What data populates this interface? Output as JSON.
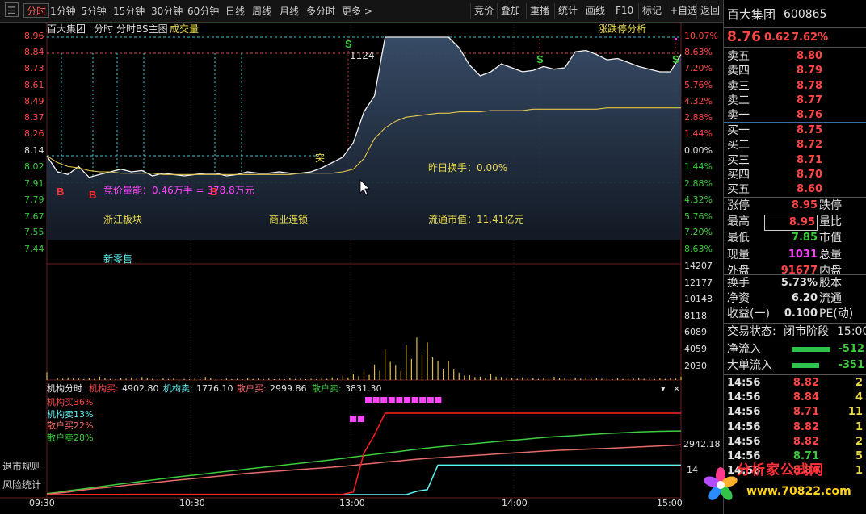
{
  "toolbar": {
    "tabs": [
      "分时",
      "1分钟",
      "5分钟",
      "15分钟",
      "30分钟",
      "60分钟",
      "日线",
      "周线",
      "月线",
      "多分时",
      "更多 >"
    ],
    "right": [
      "竞价",
      "叠加",
      "重播",
      "统计",
      "画线",
      "F10",
      "标记",
      "+自选",
      "返回"
    ]
  },
  "chart": {
    "header": {
      "name": "百大集团",
      "mode": "分时",
      "indicator": "分时BS主图",
      "volume_label": "成交量",
      "limit_analysis": "涨跌停分析"
    },
    "y_prices": [
      "8.96",
      "8.84",
      "8.73",
      "8.61",
      "8.49",
      "8.37",
      "8.26",
      "8.14",
      "8.02",
      "7.91",
      "7.79",
      "7.67",
      "7.55",
      "7.44"
    ],
    "y_pcts": [
      "10.07%",
      "8.63%",
      "7.20%",
      "5.76%",
      "4.32%",
      "2.88%",
      "1.44%",
      "0.00%",
      "1.44%",
      "2.88%",
      "4.32%",
      "5.76%",
      "7.20%",
      "8.63%"
    ],
    "vol_ticks": [
      "14207",
      "12177",
      "10148",
      "8118",
      "6089",
      "4059",
      "2030"
    ],
    "annotations": {
      "peak_volume": "1124",
      "tu": "突",
      "call_auction": "竞价量能：0.46万手 = 378.8万元",
      "yesterday_turnover": "昨日换手：0.00%",
      "sector": "浙江板块",
      "industry": "商业连锁",
      "float_value": "流通市值：11.41亿元",
      "concept": "新零售"
    },
    "bs_labels": {
      "b": "B",
      "s": "S"
    },
    "time_axis": [
      "09:30",
      "10:30",
      "13:00",
      "14:00",
      "15:00"
    ],
    "price_series": [
      8.07,
      7.95,
      7.93,
      7.99,
      7.91,
      7.93,
      7.95,
      7.97,
      7.95,
      7.96,
      7.92,
      7.94,
      7.93,
      7.92,
      7.93,
      7.94,
      7.94,
      7.92,
      7.93,
      7.95,
      7.94,
      7.94,
      7.95,
      7.94,
      7.94,
      7.95,
      7.98,
      8.02,
      8.06,
      8.17,
      8.4,
      8.52,
      8.96,
      8.96,
      8.96,
      8.96,
      8.96,
      8.96,
      8.96,
      8.88,
      8.75,
      8.67,
      8.7,
      8.76,
      8.73,
      8.7,
      8.71,
      8.74,
      8.72,
      8.73,
      8.85,
      8.86,
      8.83,
      8.79,
      8.8,
      8.77,
      8.74,
      8.72,
      8.7,
      8.7,
      8.83
    ],
    "avg_series": [
      8.07,
      8.02,
      7.99,
      7.98,
      7.96,
      7.95,
      7.95,
      7.94,
      7.94,
      7.94,
      7.94,
      7.93,
      7.93,
      7.93,
      7.93,
      7.93,
      7.93,
      7.93,
      7.93,
      7.93,
      7.93,
      7.93,
      7.93,
      7.93,
      7.94,
      7.94,
      7.94,
      7.94,
      7.95,
      7.97,
      8.05,
      8.2,
      8.28,
      8.33,
      8.36,
      8.37,
      8.38,
      8.39,
      8.39,
      8.4,
      8.4,
      8.4,
      8.41,
      8.41,
      8.41,
      8.41,
      8.42,
      8.42,
      8.42,
      8.42,
      8.42,
      8.42,
      8.42,
      8.43,
      8.43,
      8.43,
      8.43,
      8.43,
      8.43,
      8.43,
      8.43
    ],
    "volumes": [
      950,
      260,
      320,
      180,
      230,
      410,
      140,
      260,
      310,
      360,
      150,
      190,
      240,
      140,
      160,
      380,
      130,
      170,
      150,
      210,
      180,
      160,
      140,
      200,
      170,
      150,
      220,
      330,
      540,
      780,
      1040,
      1900,
      3700,
      1850,
      4300,
      5200,
      4600,
      2300,
      2300,
      900,
      600,
      410,
      700,
      360,
      260,
      330,
      220,
      280,
      400,
      270,
      260,
      330,
      240,
      180,
      220,
      280,
      240,
      200,
      230,
      260,
      420
    ]
  },
  "flow": {
    "title": "机构分时",
    "legend": [
      {
        "label": "机构买:",
        "value": "4902.80",
        "color": "#ff4646"
      },
      {
        "label": "机构卖:",
        "value": "1776.10",
        "color": "#5ff2f2"
      },
      {
        "label": "散户买:",
        "value": "2999.86",
        "color": "#ff6b6b"
      },
      {
        "label": "散户卖:",
        "value": "3831.30",
        "color": "#3ccc3c"
      }
    ],
    "pct_labels": [
      {
        "text": "机构买36%",
        "color": "#ff4646"
      },
      {
        "text": "机构卖13%",
        "color": "#5ff2f2"
      },
      {
        "text": "散户买22%",
        "color": "#ff6b6b"
      },
      {
        "text": "散户卖28%",
        "color": "#3ccc3c"
      }
    ],
    "axis_vals": [
      "2942.18",
      "14"
    ],
    "controls": [
      "▾",
      "×"
    ],
    "inst_buy": [
      0,
      0,
      0,
      10,
      14,
      14,
      14,
      16,
      18,
      18,
      18,
      18,
      18,
      18,
      18,
      18,
      18,
      18,
      18,
      18,
      18,
      18,
      18,
      18,
      18,
      18,
      18,
      18,
      20,
      160,
      2500,
      3600,
      4902,
      4902,
      4902,
      4902,
      4902,
      4902,
      4902,
      4902,
      4902,
      4902,
      4902,
      4902,
      4902,
      4902,
      4902,
      4902,
      4902,
      4902,
      4902,
      4902,
      4902,
      4902,
      4902,
      4902,
      4902,
      4902,
      4902,
      4902,
      4902
    ],
    "inst_sell": [
      0,
      0,
      0,
      0,
      0,
      0,
      0,
      0,
      0,
      0,
      0,
      0,
      0,
      0,
      0,
      0,
      0,
      0,
      0,
      0,
      0,
      0,
      0,
      0,
      0,
      0,
      0,
      0,
      0,
      0,
      0,
      0,
      0,
      0,
      0,
      200,
      300,
      1776,
      1776,
      1776,
      1776,
      1776,
      1776,
      1776,
      1776,
      1776,
      1776,
      1776,
      1776,
      1776,
      1776,
      1776,
      1776,
      1776,
      1776,
      1776,
      1776,
      1776,
      1776,
      1776,
      1776
    ],
    "retail_buy": [
      20,
      90,
      150,
      250,
      320,
      390,
      450,
      520,
      590,
      650,
      720,
      780,
      850,
      910,
      970,
      1030,
      1090,
      1150,
      1220,
      1280,
      1330,
      1380,
      1420,
      1470,
      1520,
      1560,
      1600,
      1650,
      1700,
      1760,
      1830,
      1890,
      1960,
      2010,
      2070,
      2130,
      2180,
      2220,
      2260,
      2300,
      2340,
      2380,
      2420,
      2460,
      2500,
      2540,
      2580,
      2620,
      2650,
      2680,
      2710,
      2740,
      2760,
      2780,
      2810,
      2840,
      2870,
      2900,
      2930,
      2960,
      3000
    ],
    "retail_sell": [
      60,
      130,
      230,
      310,
      390,
      470,
      560,
      640,
      720,
      800,
      880,
      960,
      1040,
      1110,
      1180,
      1250,
      1330,
      1400,
      1470,
      1540,
      1610,
      1680,
      1750,
      1820,
      1890,
      1960,
      2030,
      2100,
      2180,
      2260,
      2340,
      2420,
      2500,
      2570,
      2650,
      2730,
      2800,
      2870,
      2930,
      2990,
      3040,
      3100,
      3160,
      3220,
      3270,
      3320,
      3380,
      3430,
      3480,
      3520,
      3560,
      3600,
      3640,
      3680,
      3710,
      3740,
      3770,
      3790,
      3810,
      3820,
      3831
    ]
  },
  "left_labels": [
    "退市规则",
    "风险统计"
  ],
  "panel": {
    "name": "百大集团",
    "code": "600865",
    "price": "8.76",
    "change": "0.62",
    "pct": "7.62%",
    "asks": [
      {
        "label": "卖五",
        "price": "8.80"
      },
      {
        "label": "卖四",
        "price": "8.79"
      },
      {
        "label": "卖三",
        "price": "8.78"
      },
      {
        "label": "卖二",
        "price": "8.77"
      },
      {
        "label": "卖一",
        "price": "8.76"
      }
    ],
    "bids": [
      {
        "label": "买一",
        "price": "8.75"
      },
      {
        "label": "买二",
        "price": "8.72"
      },
      {
        "label": "买三",
        "price": "8.71"
      },
      {
        "label": "买四",
        "price": "8.70"
      },
      {
        "label": "买五",
        "price": "8.60"
      }
    ],
    "stats": [
      {
        "l1": "涨停",
        "v": "8.95",
        "vc": "#ff4646",
        "l2": "跌停"
      },
      {
        "l1": "最高",
        "v": "8.95",
        "vc": "#ff4646",
        "l2": "量比",
        "boxed": true
      },
      {
        "l1": "最低",
        "v": "7.85",
        "vc": "#3ccc3c",
        "l2": "市值"
      },
      {
        "l1": "现量",
        "v": "1031",
        "vc": "#ff44ff",
        "l2": "总量"
      },
      {
        "l1": "外盘",
        "v": "91677",
        "vc": "#ff4646",
        "l2": "内盘"
      }
    ],
    "stats2": [
      {
        "l1": "换手",
        "v": "5.73%",
        "l2": "股本"
      },
      {
        "l1": "净资",
        "v": "6.20",
        "l2": "流通"
      },
      {
        "l1": "收益(一)",
        "v": "0.100",
        "l2": "PE(动)"
      }
    ],
    "status_label": "交易状态:",
    "status_value": "闭市阶段",
    "status_time": "15:00",
    "flows": [
      {
        "label": "净流入",
        "value": "-512"
      },
      {
        "label": "大单流入",
        "value": "-351"
      }
    ],
    "ticks": [
      {
        "t": "14:56",
        "p": "8.82",
        "c": "#ff4646",
        "v": "2"
      },
      {
        "t": "14:56",
        "p": "8.84",
        "c": "#ff4646",
        "v": "4"
      },
      {
        "t": "14:56",
        "p": "8.71",
        "c": "#ff4646",
        "v": "11"
      },
      {
        "t": "14:56",
        "p": "8.82",
        "c": "#ff4646",
        "v": "1"
      },
      {
        "t": "14:56",
        "p": "8.82",
        "c": "#ff4646",
        "v": "2"
      },
      {
        "t": "14:56",
        "p": "8.71",
        "c": "#3ccc3c",
        "v": "5"
      },
      {
        "t": "14:56",
        "p": "8.84",
        "c": "#ff4646",
        "v": "1"
      }
    ]
  },
  "watermark": {
    "text": "分析家公式网",
    "url": "www.70822.com"
  }
}
